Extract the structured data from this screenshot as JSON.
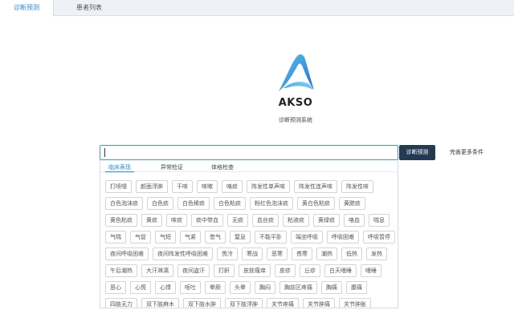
{
  "tabs": [
    "诊断预测",
    "患者列表"
  ],
  "brand": "AKSO",
  "subtitle": "诊断预测系统",
  "search": {
    "value": "",
    "button": "诊断预测",
    "more": "完善更多条件"
  },
  "panel_tabs": [
    "临床表现",
    "异常检证",
    "体格检查"
  ],
  "tags": [
    [
      "打喷嚏",
      "颜面浮肿",
      "干咳",
      "咳嗽",
      "咯痰",
      "阵发性单声咳",
      "阵发性连声咳",
      "阵发性咳"
    ],
    [
      "白色泡沫痰",
      "白色痰",
      "白色稀痰",
      "白色粘痰",
      "粉红色泡沫痰",
      "黄白色粘痰",
      "黄脓痰"
    ],
    [
      "黄色粘痰",
      "黄痰",
      "咳痰",
      "痰中带血",
      "无痰",
      "血丝痰",
      "粘液痰",
      "黄绿痰",
      "咯血",
      "喘息"
    ],
    [
      "气喘",
      "气促",
      "气短",
      "气紧",
      "憋气",
      "窒息",
      "不能平卧",
      "端坐呼吸",
      "呼吸困难",
      "呼吸暂停"
    ],
    [
      "夜间呼吸困难",
      "夜间阵发性呼吸困难",
      "畏冷",
      "寒战",
      "恶寒",
      "畏寒",
      "潮热",
      "低热",
      "发热"
    ],
    [
      "午后潮热",
      "大汗淋漓",
      "夜间盗汗",
      "打鼾",
      "皮肤瘙痒",
      "皮疹",
      "丘疹",
      "白天嗜睡",
      "嗜睡"
    ],
    [
      "恶心",
      "心慌",
      "心悸",
      "呕吐",
      "晕厥",
      "头晕",
      "胸闷",
      "胸前区疼痛",
      "胸痛",
      "腹痛"
    ],
    [
      "四肢无力",
      "双下肢麻木",
      "双下肢水肿",
      "双下肢浮肿",
      "关节疼痛",
      "关节肿痛",
      "关节肿胀"
    ]
  ]
}
